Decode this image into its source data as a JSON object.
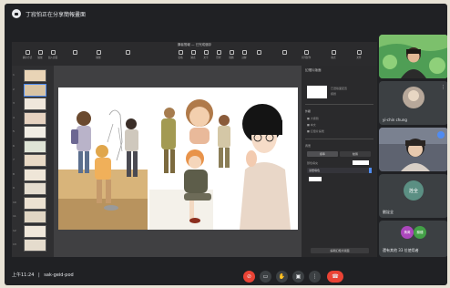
{
  "meeting": {
    "title": "丁寂怕正在分享簡報畫面",
    "clock": "上午11:24",
    "separator": "|",
    "code": "sak-geid-pod"
  },
  "share": {
    "file_name": "講者簡報 — 已完成儲存",
    "toolbar": [
      "顯示方式",
      "縮放",
      "加入頁面",
      "",
      "播放",
      "",
      "表格",
      "圖表",
      "文字",
      "形狀",
      "媒體",
      "註解",
      "",
      "",
      "共同製作",
      "格式",
      "文件"
    ],
    "thumb_numbers": [
      "1",
      "2",
      "3",
      "4",
      "5",
      "6",
      "7",
      "8",
      "9",
      "10",
      "11",
      "12",
      "13"
    ],
    "panel": {
      "tab_label": "幻燈片版面",
      "layout_name": "已選版面配置",
      "layout_sub": "標題",
      "section_a": "外觀",
      "opt1": "■ 大標題",
      "opt2": "■ 本文",
      "opt3": "■ 幻燈片編號",
      "section_b": "背景",
      "seg_left": "標準",
      "seg_right": "動態",
      "row_label": "顏色填充",
      "row_value": "漸層填色",
      "bottom_button": "編輯幻燈片版面"
    }
  },
  "participants": [
    {
      "name": ""
    },
    {
      "name": "yi-chin chung"
    },
    {
      "name": ""
    },
    {
      "name": "劉詮全",
      "avatar": "詮全"
    },
    {
      "name": "還有其他 33 位使用者",
      "avatars": [
        "黃萬",
        "錦鍾"
      ]
    }
  ],
  "controls": [
    {
      "icon": "mic-off-icon",
      "glyph": "⊘"
    },
    {
      "icon": "camera-icon",
      "glyph": "▭"
    },
    {
      "icon": "hand-icon",
      "glyph": "✋"
    },
    {
      "icon": "present-icon",
      "glyph": "▣"
    },
    {
      "icon": "more-icon",
      "glyph": "⋮"
    },
    {
      "icon": "hangup-icon",
      "glyph": "☎"
    }
  ],
  "colors": {
    "accent": "#4f8cf2",
    "hangup": "#ea4335",
    "mute": "#ea4335",
    "tile_bg": "#3c4043",
    "avatar1": "#5b8f83",
    "avatar2": "#ab47bc",
    "avatar3": "#43a047"
  }
}
